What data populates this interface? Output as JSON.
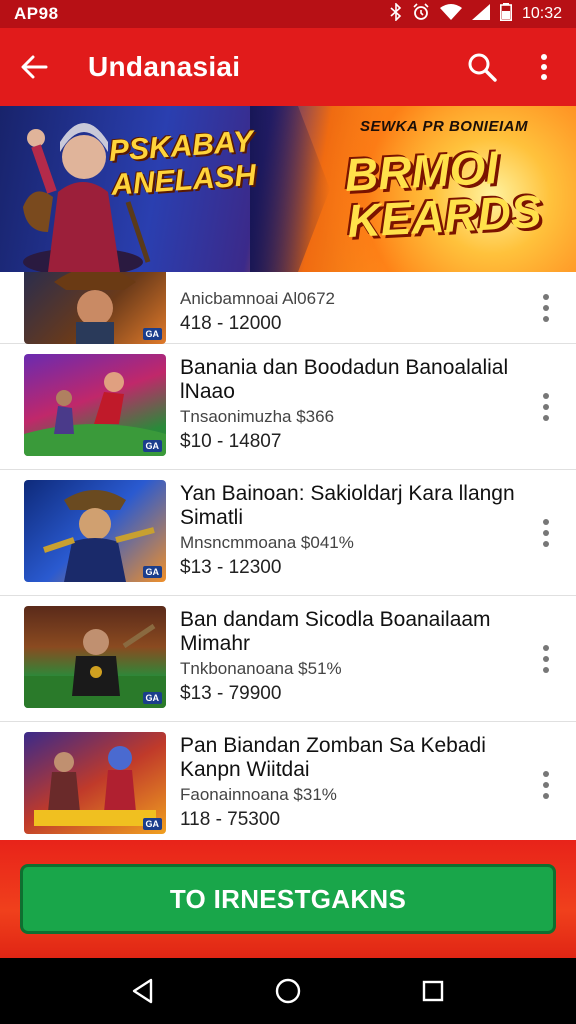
{
  "status_bar": {
    "carrier": "AP98",
    "time": "10:32",
    "icons": [
      "bluetooth-icon",
      "alarm-icon",
      "wifi-icon",
      "signal-icon",
      "battery-icon"
    ]
  },
  "app_bar": {
    "title": "Undanasiai",
    "background": "#e11b1b",
    "icons": [
      "back-arrow-icon",
      "search-icon",
      "more-vert-icon"
    ]
  },
  "banner": {
    "left_text": "PSKABAY ANELASH",
    "right_subtitle": "SEWKA PR BONIEIAM",
    "right_title": "BRMOI KEARDS"
  },
  "items": [
    {
      "title": "Anicbamnoai Al0672",
      "subtitle": "",
      "price": "418 - 12000"
    },
    {
      "title": "Banania dan Boodadun Banoalalial lNaao",
      "subtitle": "Tnsaonimuzha $366",
      "price": "$10 - 14807"
    },
    {
      "title": "Yan Bainoan: Sakioldarj Kara llangn Simatli",
      "subtitle": "Mnsncmmoana $041%",
      "price": "$13 - 12300"
    },
    {
      "title": "Ban dandam Sicodla Boanailaam Mimahr",
      "subtitle": "Tnkbonanoana $51%",
      "price": "$13 - 79900"
    },
    {
      "title": "Pan Biandan Zomban Sa Kebadi Kanpn Wiitdai",
      "subtitle": "Faonainnoana $31%",
      "price": "118 - 75300"
    }
  ],
  "thumb_badge": "GA",
  "cta": {
    "label": "TO IRNESTGAKNS",
    "color": "#19a64a"
  },
  "nav_bar": {
    "icons": [
      "back-triangle-icon",
      "home-circle-icon",
      "recents-square-icon"
    ]
  }
}
